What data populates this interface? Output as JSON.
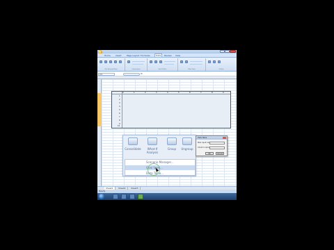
{
  "app": {
    "quick_access": "",
    "tabs": [
      "Home",
      "Insert",
      "Page Layout",
      "Formulas",
      "Data",
      "Review",
      "View"
    ],
    "active_tab": "Data",
    "groups": [
      "Get External Data",
      "Connections",
      "Sort & Filter",
      "Data Tools",
      "Outline"
    ]
  },
  "formula_bar": {
    "name_box": "C3",
    "fx": "fx",
    "formula": ""
  },
  "table": {
    "header_values": [
      "0",
      "1",
      "2",
      "3",
      "4",
      "5",
      "6",
      "7",
      "8",
      "9"
    ],
    "row_values": [
      "1",
      "2",
      "3",
      "4",
      "5",
      "6",
      "7",
      "8",
      "9",
      "10"
    ]
  },
  "whatif": {
    "buttons": [
      {
        "label": "Consolidate",
        "icon": "consolidate-icon"
      },
      {
        "label": "What-If Analysis",
        "icon": "what-if-icon"
      },
      {
        "label": "Group",
        "icon": "group-icon"
      },
      {
        "label": "Ungroup",
        "icon": "ungroup-icon"
      }
    ],
    "menu": [
      "Scenario Manager...",
      "Goal Seek...",
      "Data Table..."
    ],
    "highlighted_index": 1
  },
  "dialog": {
    "title": "Data Table",
    "row_label": "Row input cell:",
    "col_label": "Column input cell:",
    "ok": "OK",
    "cancel": "Cancel"
  },
  "sheets": [
    "Sheet1",
    "Sheet2",
    "Sheet3"
  ],
  "active_sheet": "Sheet1",
  "status": "Ready",
  "taskbar": {
    "time": "",
    "date": ""
  },
  "colors": {
    "accent": "#15428b",
    "ribbon": "#dbe7f7",
    "highlight": "#c9daf0"
  }
}
